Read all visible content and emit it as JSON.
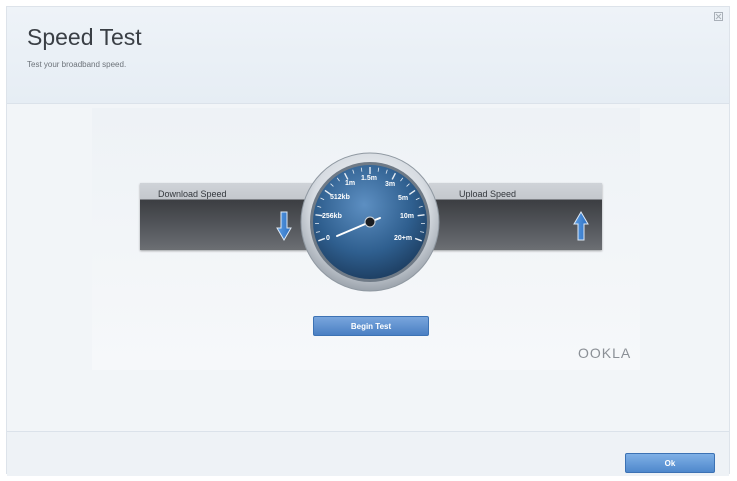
{
  "header": {
    "title": "Speed Test",
    "subtitle": "Test your broadband speed."
  },
  "speed_test": {
    "download_label": "Download Speed",
    "upload_label": "Upload Speed",
    "gauge_scale": [
      "0",
      "256kb",
      "512kb",
      "1m",
      "1.5m",
      "3m",
      "5m",
      "10m",
      "20+m"
    ],
    "begin_button": "Begin Test",
    "provider_logo": "OOKLA"
  },
  "footer": {
    "ok_button": "Ok"
  },
  "colors": {
    "accent_blue": "#4a7fc3",
    "gauge_face": "#2f5f8f"
  }
}
